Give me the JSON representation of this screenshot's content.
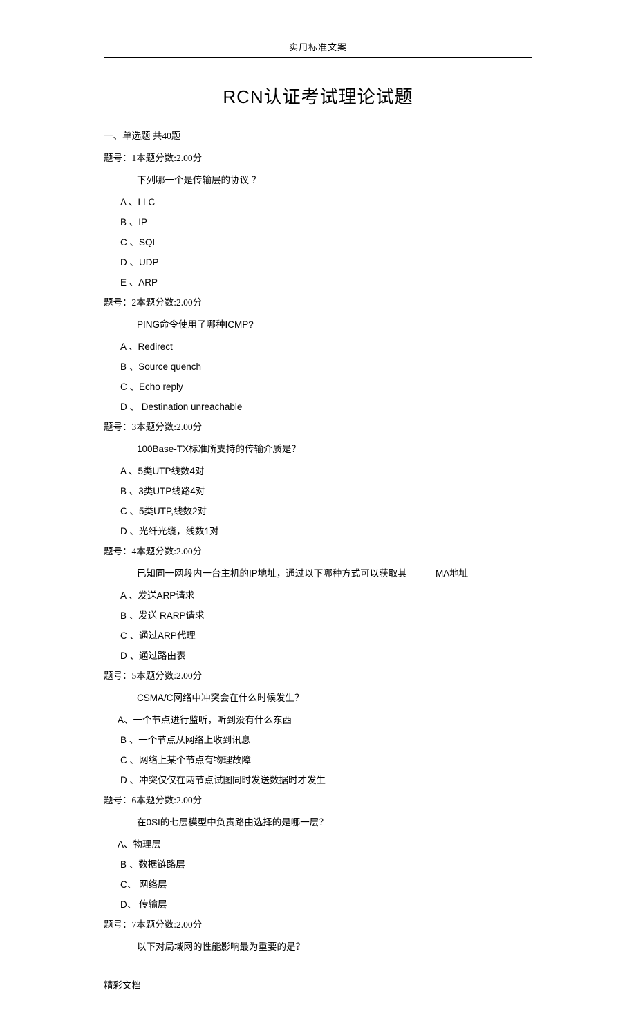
{
  "header": "实用标准文案",
  "title": "RCN认证考试理论试题",
  "section_heading": "一、单选题  共40题",
  "questions": [
    {
      "line": "题号：1本题分数:2.00分",
      "text": "下列哪一个是传输层的协议  ？",
      "options": [
        "A 、LLC",
        "B 、IP",
        "C 、SQL",
        "D 、UDP",
        "E 、ARP"
      ]
    },
    {
      "line": "题号：2本题分数:2.00分",
      "text": "PING命令使用了哪种ICMP?",
      "options": [
        "A 、Redirect",
        "B 、Source quench",
        "C 、Echo reply",
        "D 、  Destination unreachable"
      ]
    },
    {
      "line": "题号：3本题分数:2.00分",
      "text": "100Base-TX标准所支持的传输介质是？",
      "options": [
        "A 、5类UTP线数4对",
        "B 、3类UTP线路4对",
        "C 、5类UTP,线数2对",
        "D 、光纤光缆，线数1对"
      ]
    },
    {
      "line": "题号：4本题分数:2.00分",
      "text": "已知同一网段内一台主机的IP地址，通过以下哪种方式可以获取其",
      "text_extra": "MA地址",
      "options": [
        "A 、发送ARP请求",
        "B 、发送  RARP请求",
        "C 、通过ARP代理",
        "D 、通过路由表"
      ]
    },
    {
      "line": "题号：5本题分数:2.00分",
      "text": "CSMA/C网络中冲突会在什么时候发生？",
      "options": [
        "A、一个节点进行监听，听到没有什么东西",
        "B 、一个节点从网络上收到讯息",
        "C 、网络上某个节点有物理故障",
        "D 、冲突仅仅在两节点试图同时发送数据时才发生"
      ]
    },
    {
      "line": "题号：6本题分数:2.00分",
      "text": "在0SI的七层模型中负责路由选择的是哪一层？",
      "options": [
        "A、物理层",
        "B 、数据链路层",
        "C、  网络层",
        "D、  传输层"
      ]
    },
    {
      "line": "题号：7本题分数:2.00分",
      "text": "以下对局域网的性能影响最为重要的是？",
      "options": []
    }
  ],
  "footer": "精彩文档"
}
